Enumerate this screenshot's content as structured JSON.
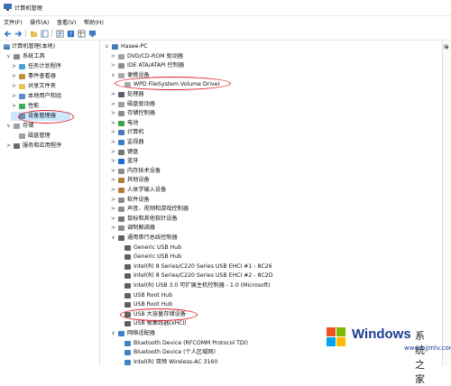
{
  "window": {
    "title": "计算机管理"
  },
  "menu": [
    {
      "label": "文件(F)"
    },
    {
      "label": "操作(A)"
    },
    {
      "label": "查看(V)"
    },
    {
      "label": "帮助(H)"
    }
  ],
  "toolbar": [
    {
      "name": "back-arrow-icon",
      "glyph": "←"
    },
    {
      "name": "forward-arrow-icon",
      "glyph": "→"
    },
    {
      "name": "up-folder-icon",
      "glyph": "▣"
    },
    {
      "name": "show-hide-tree-icon",
      "glyph": "▤"
    },
    {
      "name": "properties-icon",
      "glyph": "▦"
    },
    {
      "name": "help-icon",
      "glyph": "?"
    },
    {
      "name": "view-icon",
      "glyph": "▥"
    },
    {
      "name": "monitor-icon",
      "glyph": "▭"
    }
  ],
  "left_tree": [
    {
      "label": "计算机管理(本地)",
      "exp": "",
      "icon": "comp"
    },
    {
      "label": "系统工具",
      "exp": "∨",
      "icon": "tool"
    },
    {
      "label": "任务计划程序",
      "exp": ">",
      "icon": "clock"
    },
    {
      "label": "事件查看器",
      "exp": ">",
      "icon": "book"
    },
    {
      "label": "共享文件夹",
      "exp": ">",
      "icon": "folder"
    },
    {
      "label": "本地用户和组",
      "exp": ">",
      "icon": "users"
    },
    {
      "label": "性能",
      "exp": ">",
      "icon": "perf"
    },
    {
      "label": "设备管理器",
      "exp": "",
      "icon": "dev"
    },
    {
      "label": "存储",
      "exp": "∨",
      "icon": "disk"
    },
    {
      "label": "磁盘管理",
      "exp": "",
      "icon": "disk"
    },
    {
      "label": "服务和应用程序",
      "exp": ">",
      "icon": "svc"
    }
  ],
  "device_tree": [
    {
      "label": "Hasee-PC",
      "exp": "∨",
      "icon": "pc"
    },
    {
      "label": "DVD/CD-ROM 驱动器",
      "exp": ">",
      "icon": "dvd"
    },
    {
      "label": "IDE ATA/ATAPI 控制器",
      "exp": ">",
      "icon": "ide"
    },
    {
      "label": "便携设备",
      "exp": "∨",
      "icon": "port"
    },
    {
      "label": "WPD FileSystem Volume Driver",
      "exp": "",
      "icon": "port"
    },
    {
      "label": "处理器",
      "exp": ">",
      "icon": "cpu"
    },
    {
      "label": "磁盘驱动器",
      "exp": ">",
      "icon": "disk"
    },
    {
      "label": "存储控制器",
      "exp": ">",
      "icon": "ide"
    },
    {
      "label": "电池",
      "exp": ">",
      "icon": "bat"
    },
    {
      "label": "计算机",
      "exp": ">",
      "icon": "pc"
    },
    {
      "label": "监视器",
      "exp": ">",
      "icon": "mon"
    },
    {
      "label": "键盘",
      "exp": ">",
      "icon": "kb"
    },
    {
      "label": "蓝牙",
      "exp": ">",
      "icon": "bt"
    },
    {
      "label": "内存技术设备",
      "exp": ">",
      "icon": "ide"
    },
    {
      "label": "其他设备",
      "exp": ">",
      "icon": "hid"
    },
    {
      "label": "人体学输入设备",
      "exp": ">",
      "icon": "hid"
    },
    {
      "label": "软件设备",
      "exp": ">",
      "icon": "ide"
    },
    {
      "label": "声音、视频和游戏控制器",
      "exp": ">",
      "icon": "sound"
    },
    {
      "label": "鼠标和其他指针设备",
      "exp": ">",
      "icon": "kb"
    },
    {
      "label": "调制解调器",
      "exp": ">",
      "icon": "ide"
    },
    {
      "label": "通用串行总线控制器",
      "exp": "∨",
      "icon": "usb"
    },
    {
      "label": "Generic USB Hub",
      "exp": "",
      "icon": "usb"
    },
    {
      "label": "Generic USB Hub",
      "exp": "",
      "icon": "usb"
    },
    {
      "label": "Intel(R) 8 Series/C220 Series USB EHCI #1 - 8C26",
      "exp": "",
      "icon": "usb"
    },
    {
      "label": "Intel(R) 8 Series/C220 Series USB EHCI #2 - 8C2D",
      "exp": "",
      "icon": "usb"
    },
    {
      "label": "Intel(R) USB 3.0 可扩展主机控制器 - 1.0 (Microsoft)",
      "exp": "",
      "icon": "usb"
    },
    {
      "label": "USB Root Hub",
      "exp": "",
      "icon": "usb"
    },
    {
      "label": "USB Root Hub",
      "exp": "",
      "icon": "usb"
    },
    {
      "label": "USB 大容量存储设备",
      "exp": "",
      "icon": "usb"
    },
    {
      "label": "USB 根集线器(xHCI)",
      "exp": "",
      "icon": "usb"
    },
    {
      "label": "网络适配器",
      "exp": "∨",
      "icon": "net"
    },
    {
      "label": "Bluetooth Device (RFCOMM Protocol TDI)",
      "exp": "",
      "icon": "net"
    },
    {
      "label": "Bluetooth Device (个人区域网)",
      "exp": "",
      "icon": "net"
    },
    {
      "label": "Intel(R) 双频 Wireless-AC 3160",
      "exp": "",
      "icon": "net"
    }
  ],
  "action_pane": {
    "label": "操"
  },
  "watermark": {
    "brand": "Windows",
    "tagline": "系统之家",
    "url": "www.bjjmlv.com",
    "colors": [
      "#f25022",
      "#7fba00",
      "#00a4ef",
      "#ffb900"
    ]
  }
}
